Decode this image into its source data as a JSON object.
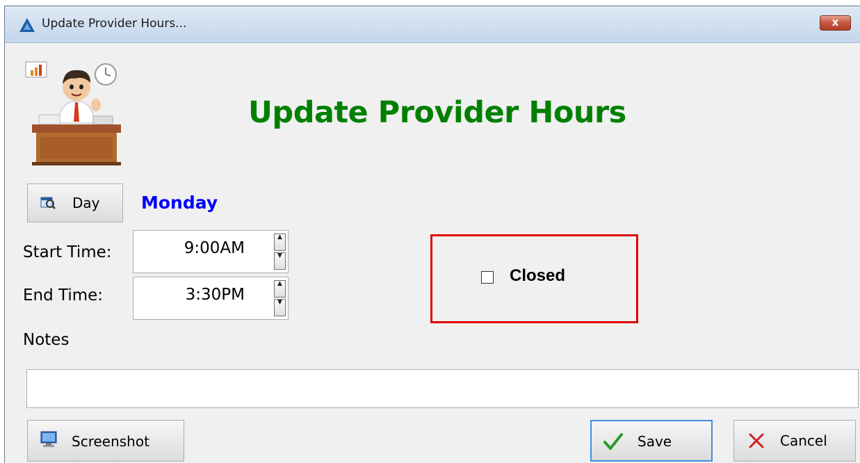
{
  "window": {
    "title": "Update Provider Hours...",
    "close_label": "x"
  },
  "header": {
    "heading": "Update Provider Hours"
  },
  "day": {
    "button_label": "Day",
    "value": "Monday"
  },
  "start_time": {
    "label": "Start Time:",
    "value": "9:00AM"
  },
  "end_time": {
    "label": "End Time:",
    "value": "3:30PM"
  },
  "closed": {
    "label": "Closed",
    "checked": false
  },
  "notes": {
    "label": "Notes",
    "value": ""
  },
  "footer": {
    "screenshot_label": "Screenshot",
    "save_label": "Save",
    "cancel_label": "Cancel"
  },
  "colors": {
    "heading": "#008000",
    "day_value": "#0000ff",
    "closed_border": "#e00000",
    "save_border": "#3c8ee0"
  },
  "icons": {
    "app": "app-logo-icon",
    "day": "calendar-search-icon",
    "screenshot": "monitor-icon",
    "save": "checkmark-icon",
    "cancel": "x-icon"
  }
}
